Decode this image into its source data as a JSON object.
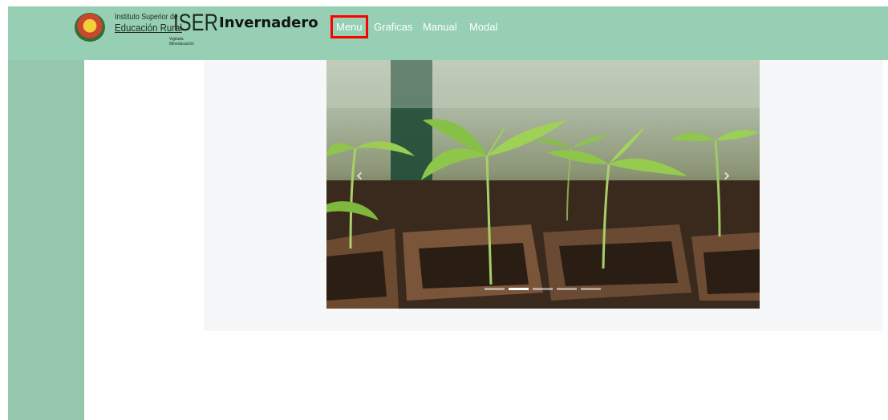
{
  "header": {
    "logo": {
      "line1": "Instituto Superior de",
      "line2": "Educación Rural",
      "acronym": "ISER",
      "tagline": "Vigilada Mineducación"
    },
    "brand": "Invernadero",
    "nav": [
      {
        "label": "Menu",
        "active": true
      },
      {
        "label": "Graficas",
        "active": false
      },
      {
        "label": "Manual",
        "active": false
      },
      {
        "label": "Modal",
        "active": false
      }
    ]
  },
  "colors": {
    "navbar": "#96cfb4",
    "sidebar": "#94c7ab",
    "content_panel": "#f6f7f9",
    "highlight": "#ff0000"
  },
  "carousel": {
    "image": "seedling-sprouts-photo",
    "prev_icon": "chevron-left-icon",
    "next_icon": "chevron-right-icon",
    "slide_count": 5,
    "active_index": 1
  }
}
